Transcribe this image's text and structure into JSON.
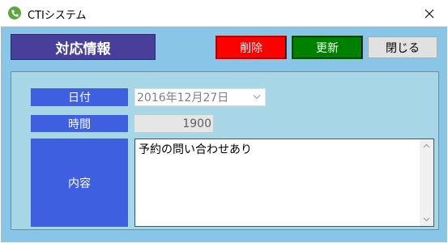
{
  "window": {
    "title": "CTIシステム",
    "app_icon": "phone-icon",
    "close_icon": "close-icon"
  },
  "header": {
    "title": "対応情報"
  },
  "toolbar": {
    "delete_label": "削除",
    "update_label": "更新",
    "close_label": "閉じる"
  },
  "form": {
    "date_label": "日付",
    "date_value": "2016年12月27日",
    "time_label": "時間",
    "time_value": "1900",
    "content_label": "内容",
    "content_value": "予約の問い合わせあり"
  },
  "colors": {
    "client_bg": "#89c5e7",
    "panel_bg": "#a7d6e6",
    "header_bg": "#493f9a",
    "label_bg": "#3d5fe0",
    "delete_bg": "#ff0000",
    "update_bg": "#008000"
  }
}
